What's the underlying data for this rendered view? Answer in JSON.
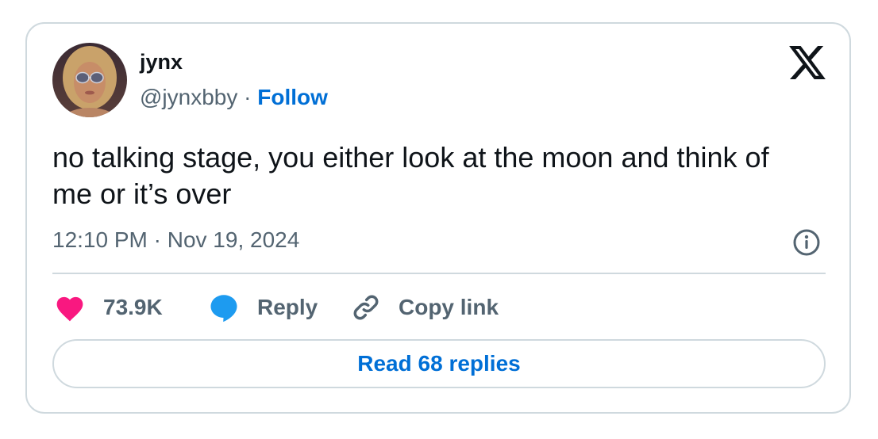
{
  "author": {
    "display_name": "jynx",
    "handle": "@jynxbby",
    "separator": " · ",
    "follow_label": "Follow",
    "avatar_icon": "profile-photo"
  },
  "brand": {
    "logo_icon": "x-logo-icon"
  },
  "tweet": {
    "text": "no talking stage, you either look at the moon and think of me or it’s over",
    "timestamp": "12:10 PM · Nov 19, 2024"
  },
  "actions": {
    "like_count": "73.9K",
    "reply_label": "Reply",
    "copy_link_label": "Copy link",
    "like_color": "#f91880",
    "reply_color": "#1d9bf0"
  },
  "footer": {
    "read_replies_label": "Read 68 replies"
  },
  "colors": {
    "link": "#006fd6",
    "muted_text": "#536471",
    "border": "#cfd9de",
    "text": "#0f1419"
  }
}
